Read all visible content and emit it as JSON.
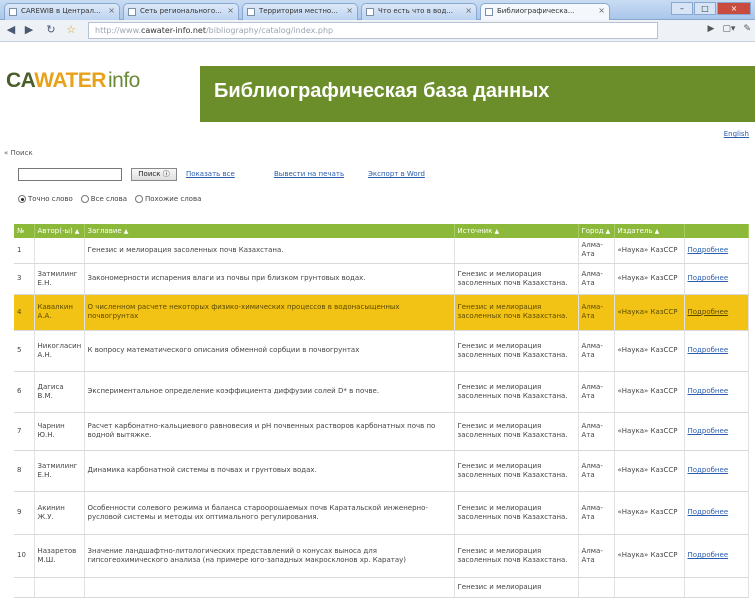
{
  "browser": {
    "tabs": [
      {
        "label": "CAREWIB в Централ..."
      },
      {
        "label": "Сеть регионального..."
      },
      {
        "label": "Территория местно..."
      },
      {
        "label": "Что есть что в вод..."
      },
      {
        "label": "Библиографическа..."
      }
    ],
    "url_prefix": "http://www.",
    "url_domain": "cawater-info.net",
    "url_path": "/bibliography/catalog/index.php"
  },
  "site": {
    "logo_ca": "CA",
    "logo_water": "WATER",
    "logo_info": "info",
    "banner_title": "Библиографическая база данных",
    "english_link": "English"
  },
  "search": {
    "toggle_label": "« Поиск",
    "button_label": "Поиск ⓘ",
    "show_all_link": "Показать все",
    "print_link": "Вывести на печать",
    "export_link": "Экспорт в Word",
    "radio_exact": "Точно слово",
    "radio_all": "Все слова",
    "radio_partial": "Похожие слова"
  },
  "table": {
    "headers": [
      "№",
      "Автор(-ы)",
      "Заглавие",
      "Источник",
      "Город",
      "Издатель",
      ""
    ],
    "rows": [
      {
        "num": "1",
        "author": "",
        "title": "Генезис и мелиорация засоленных почв Казахстана.",
        "source": "",
        "city": "Алма-Ата",
        "publisher": "«Наука» КазССР",
        "more": "Подробнее"
      },
      {
        "num": "3",
        "author": "Затмилинг Е.Н.",
        "title": "Закономерности испарения влаги из почвы при близком грунтовых водах.",
        "source": "Генезис и мелиорация засоленных почв Казахстана.",
        "city": "Алма-Ата",
        "publisher": "«Наука» КазССР",
        "more": "Подробнее"
      },
      {
        "num": "4",
        "author": "Кавалкин А.А.",
        "title": "О численном расчете некоторых физико-химических процессов в водонасыщенных почвогрунтах",
        "source": "Генезис и мелиорация засоленных почв Казахстана.",
        "city": "Алма-Ата",
        "publisher": "«Наука» КазССР",
        "more": "Подробнее"
      },
      {
        "num": "5",
        "author": "Никогласин А.Н.",
        "title": "К вопросу математического описания обменной сорбции в почвогрунтах",
        "source": "Генезис и мелиорация засоленных почв Казахстана.",
        "city": "Алма-Ата",
        "publisher": "«Наука» КазССР",
        "more": "Подробнее"
      },
      {
        "num": "6",
        "author": "Дагиса В.М.",
        "title": "Экспериментальное определение коэффициента диффузии солей D* в почве.",
        "source": "Генезис и мелиорация засоленных почв Казахстана.",
        "city": "Алма-Ата",
        "publisher": "«Наука» КазССР",
        "more": "Подробнее"
      },
      {
        "num": "7",
        "author": "Чарнин Ю.Н.",
        "title": "Расчет карбонатно-кальциевого равновесия и pH почвенных растворов карбонатных почв по водной вытяжке.",
        "source": "Генезис и мелиорация засоленных почв Казахстана.",
        "city": "Алма-Ата",
        "publisher": "«Наука» КазССР",
        "more": "Подробнее"
      },
      {
        "num": "8",
        "author": "Затмилинг Е.Н.",
        "title": "Динамика карбонатной системы в почвах и грунтовых водах.",
        "source": "Генезис и мелиорация засоленных почв Казахстана.",
        "city": "Алма-Ата",
        "publisher": "«Наука» КазССР",
        "more": "Подробнее"
      },
      {
        "num": "9",
        "author": "Акинин Ж.У.",
        "title": "Особенности солевого режима и баланса староорошаемых почв Каратальской инженерно-русловой системы и методы их оптимального регулирования.",
        "source": "Генезис и мелиорация засоленных почв Казахстана.",
        "city": "Алма-Ата",
        "publisher": "«Наука» КазССР",
        "more": "Подробнее"
      },
      {
        "num": "10",
        "author": "Назаретов М.Ш.",
        "title": "Значение ландшафтно-литологических представлений о конусах выноса для гипсогеохимического анализа (на примере юго-западных макросклонов хр. Каратау)",
        "source": "Генезис и мелиорация засоленных почв Казахстана.",
        "city": "Алма-Ата",
        "publisher": "«Наука» КазССР",
        "more": "Подробнее"
      },
      {
        "num": "",
        "author": "",
        "title": "",
        "source": "Генезис и мелиорация",
        "city": "",
        "publisher": "",
        "more": ""
      }
    ]
  },
  "colors": {
    "banner": "#6b8d2a",
    "table_header": "#8db93a",
    "highlight_row": "#f2c214",
    "link": "#2a5db0"
  }
}
